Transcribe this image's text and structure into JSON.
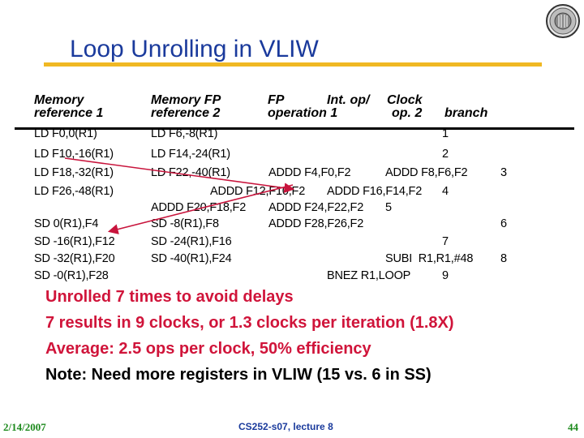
{
  "slide": {
    "title": "Loop Unrolling in VLIW",
    "colors": {
      "title": "#1a3a9c",
      "rule": "#f0b823",
      "emphasis": "#d0143a",
      "footer_green": "#1d8a1d",
      "arrow": "#c8143c"
    }
  },
  "table": {
    "headers": [
      {
        "line1": "Memory",
        "line2": "reference 1"
      },
      {
        "line1": "Memory FP",
        "line2": "reference 2"
      },
      {
        "line1": "FP",
        "line2": "operation 1"
      },
      {
        "line1": "Int. op/",
        "line2": "op. 2"
      },
      {
        "line1": "Clock",
        "line2": ""
      },
      {
        "line1": "",
        "line2": "branch"
      }
    ],
    "header_fp2": "FP",
    "rows": [
      {
        "mem1": "LD F0,0(R1)",
        "mem2": "LD F6,-8(R1)",
        "fp1": "",
        "fp2": "",
        "int": "",
        "clock": "1"
      },
      {
        "mem1": "LD F10,-16(R1)",
        "mem2": "LD F14,-24(R1)",
        "fp1": "",
        "fp2": "",
        "int": "",
        "clock": "2"
      },
      {
        "mem1": "LD F18,-32(R1)",
        "mem2": "LD F22,-40(R1)",
        "fp1": "ADDD F4,F0,F2",
        "fp2": "ADDD F8,F6,F2",
        "int": "",
        "clock": "3"
      },
      {
        "mem1": "LD F26,-48(R1)",
        "mem2": "",
        "fp1": "ADDD F12,F10,F2",
        "fp2": "ADDD F16,F14,F2",
        "int": "",
        "clock": "4"
      },
      {
        "mem1": "",
        "mem2": "",
        "fp1": "ADDD F20,F18,F2",
        "fp2": "ADDD F24,F22,F2",
        "int": "",
        "clock": "5"
      },
      {
        "mem1": "SD 0(R1),F4",
        "mem2": "SD -8(R1),F8",
        "fp1": "ADDD F28,F26,F2",
        "fp2": "",
        "int": "",
        "clock": "6"
      },
      {
        "mem1": "SD -16(R1),F12",
        "mem2": "SD -24(R1),F16",
        "fp1": "",
        "fp2": "",
        "int": "",
        "clock": "7"
      },
      {
        "mem1": "SD -32(R1),F20",
        "mem2": "SD -40(R1),F24",
        "fp1": "",
        "fp2": "",
        "int": "SUBI  R1,R1,#48",
        "clock": "8"
      },
      {
        "mem1": "SD -0(R1),F28",
        "mem2": "",
        "fp1": "",
        "fp2": "",
        "int": "BNEZ R1,LOOP",
        "clock": "9"
      }
    ]
  },
  "notes": [
    {
      "text": "Unrolled 7 times to avoid delays",
      "style": "emphasis"
    },
    {
      "text": "7 results in 9 clocks, or 1.3 clocks per iteration (1.8X)",
      "style": "emphasis"
    },
    {
      "text": "Average: 2.5 ops per clock, 50% efficiency",
      "style": "emphasis"
    },
    {
      "text": "Note: Need more registers in VLIW (15 vs. 6 in SS)",
      "style": "normal"
    }
  ],
  "footer": {
    "date": "2/14/2007",
    "course": "CS252-s07, lecture 8",
    "page": "44"
  },
  "icons": {
    "seal": "university-seal-icon",
    "arrows": [
      "dependency-arrow-load-to-add",
      "dependency-arrow-add-to-store"
    ]
  }
}
